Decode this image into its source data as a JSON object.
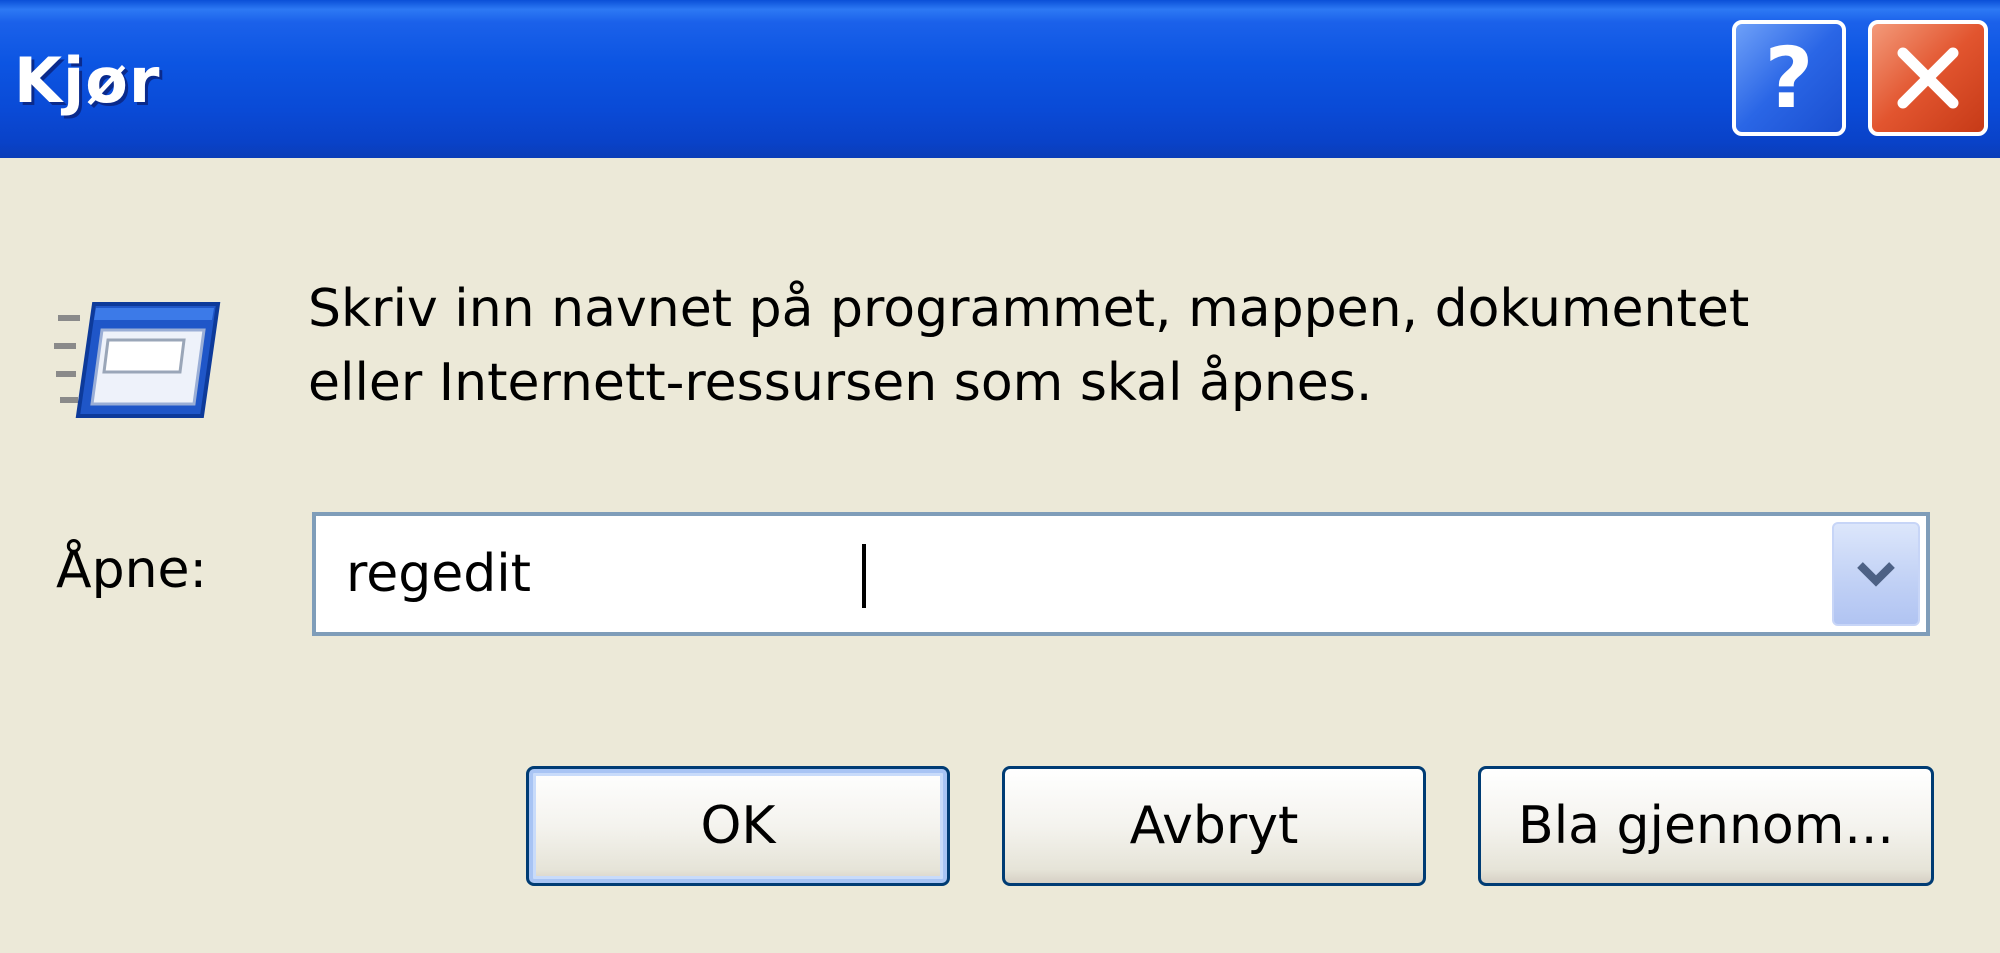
{
  "window": {
    "title": "Kjør",
    "help_glyph": "?",
    "close_glyph": "x"
  },
  "dialog": {
    "icon": "run-program-icon",
    "prompt_line1": "Skriv inn navnet på programmet, mappen, dokumentet",
    "prompt_line2": "eller Internett-ressursen som skal åpnes.",
    "open_label": "Åpne:",
    "open_value": "regedit"
  },
  "buttons": {
    "ok": "OK",
    "cancel": "Avbryt",
    "browse": "Bla gjennom..."
  },
  "colors": {
    "titlebar": "#0a4ad6",
    "dialog_bg": "#ece9d8",
    "help_button": "#2a66e6",
    "close_button": "#e2552f",
    "button_border": "#003c74"
  }
}
